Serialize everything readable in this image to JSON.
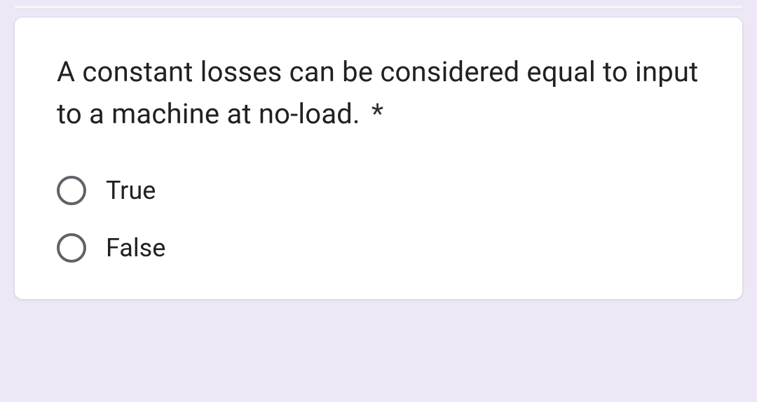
{
  "question": {
    "text": "A constant losses can be considered equal to input to a machine at no-load.",
    "required_marker": "*",
    "options": [
      {
        "label": "True"
      },
      {
        "label": "False"
      }
    ]
  }
}
